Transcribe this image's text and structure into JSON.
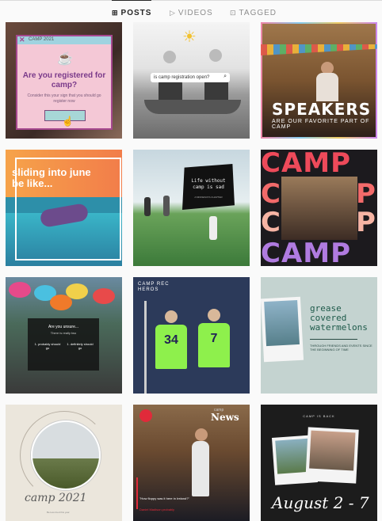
{
  "tabs": [
    {
      "icon": "grid-icon",
      "glyph": "⊞",
      "label": "POSTS",
      "active": true
    },
    {
      "icon": "video-icon",
      "glyph": "▷",
      "label": "VIDEOS",
      "active": false
    },
    {
      "icon": "tag-icon",
      "glyph": "⊡",
      "label": "TAGGED",
      "active": false
    }
  ],
  "posts": {
    "p1": {
      "window_title": "CAMP 2021",
      "question": "Are you registered for camp?",
      "subtext": "Consider this your sign that you should go register now"
    },
    "p2": {
      "search_text": "is camp registration open?"
    },
    "p3": {
      "title": "SPEAKERS",
      "subtitle": "ARE OUR FAVORITE PART OF CAMP"
    },
    "p4": {
      "text": "sliding into june be like..."
    },
    "p5": {
      "text": "Life without camp is sad",
      "small": "A MINNESOTA CHAPTER"
    },
    "p6": {
      "word": "CAMP",
      "letter_c": "C",
      "letter_p": "P"
    },
    "p7": {
      "heading": "Are you unsure...",
      "subheading": "There is really two",
      "left": "1. probably should go",
      "right": "1. definitely should go"
    },
    "p8": {
      "title": "CAMP REC HEROS",
      "jersey_a": "34",
      "jersey_b": "7"
    },
    "p9": {
      "title": "grease covered watermelons",
      "small": "THROUGH FRIENDS AND EVENTS SINCE THE BEGINNING OF TIME"
    },
    "p10": {
      "script": "camp 2021",
      "small": "Be less tired this year"
    },
    "p11": {
      "brand_small": "camp",
      "brand": "News",
      "quote": "\"How floppy was it here in Ireland?\"",
      "attribution": "Daniel Madison probably"
    },
    "p12": {
      "header": "CAMP IS BACK",
      "dates": "August 2 - 7"
    }
  }
}
